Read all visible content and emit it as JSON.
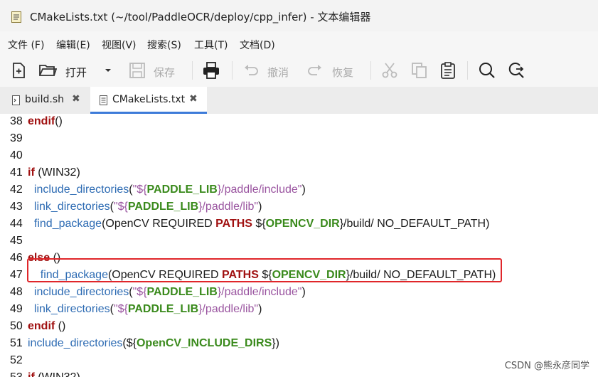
{
  "window": {
    "title": "CMakeLists.txt (~/tool/PaddleOCR/deploy/cpp_infer) - 文本编辑器"
  },
  "menu": {
    "items": [
      "文件 (F)",
      "编辑(E)",
      "视图(V)",
      "搜索(S)",
      "工具(T)",
      "文档(D)"
    ]
  },
  "toolbar": {
    "open_label": "打开",
    "save_label": "保存",
    "undo_label": "撤消",
    "redo_label": "恢复"
  },
  "tabs": [
    {
      "label": "build.sh",
      "active": false
    },
    {
      "label": "CMakeLists.txt",
      "active": true
    }
  ],
  "editor": {
    "lines": [
      {
        "n": "38",
        "tokens": [
          [
            "kw",
            "endif"
          ],
          [
            "plain",
            "()"
          ]
        ]
      },
      {
        "n": "39",
        "tokens": []
      },
      {
        "n": "40",
        "tokens": []
      },
      {
        "n": "41",
        "tokens": [
          [
            "kw",
            "if"
          ],
          [
            "plain",
            " (WIN32)"
          ]
        ]
      },
      {
        "n": "42",
        "tokens": [
          [
            "plain",
            "  "
          ],
          [
            "fn",
            "include_directories"
          ],
          [
            "plain",
            "("
          ],
          [
            "str",
            "\"${"
          ],
          [
            "var",
            "PADDLE_LIB"
          ],
          [
            "str",
            "}/paddle/include\""
          ],
          [
            "plain",
            ")"
          ]
        ]
      },
      {
        "n": "43",
        "tokens": [
          [
            "plain",
            "  "
          ],
          [
            "fn",
            "link_directories"
          ],
          [
            "plain",
            "("
          ],
          [
            "str",
            "\"${"
          ],
          [
            "var",
            "PADDLE_LIB"
          ],
          [
            "str",
            "}/paddle/lib\""
          ],
          [
            "plain",
            ")"
          ]
        ]
      },
      {
        "n": "44",
        "tokens": [
          [
            "plain",
            "  "
          ],
          [
            "fn",
            "find_package"
          ],
          [
            "plain",
            "(OpenCV REQUIRED "
          ],
          [
            "kw",
            "PATHS"
          ],
          [
            "plain",
            " ${"
          ],
          [
            "var",
            "OPENCV_DIR"
          ],
          [
            "plain",
            "}/build/ NO_DEFAULT_PATH)"
          ]
        ]
      },
      {
        "n": "45",
        "tokens": []
      },
      {
        "n": "46",
        "tokens": [
          [
            "kw",
            "else"
          ],
          [
            "plain",
            " ()"
          ]
        ]
      },
      {
        "n": "47",
        "tokens": [
          [
            "plain",
            "    "
          ],
          [
            "fn",
            "find_package"
          ],
          [
            "plain",
            "(OpenCV REQUIRED "
          ],
          [
            "kw",
            "PATHS"
          ],
          [
            "plain",
            " ${"
          ],
          [
            "var",
            "OPENCV_DIR"
          ],
          [
            "plain",
            "}/build/ NO_DEFAULT_PATH)"
          ]
        ]
      },
      {
        "n": "48",
        "tokens": [
          [
            "plain",
            "  "
          ],
          [
            "fn",
            "include_directories"
          ],
          [
            "plain",
            "("
          ],
          [
            "str",
            "\"${"
          ],
          [
            "var",
            "PADDLE_LIB"
          ],
          [
            "str",
            "}/paddle/include\""
          ],
          [
            "plain",
            ")"
          ]
        ]
      },
      {
        "n": "49",
        "tokens": [
          [
            "plain",
            "  "
          ],
          [
            "fn",
            "link_directories"
          ],
          [
            "plain",
            "("
          ],
          [
            "str",
            "\"${"
          ],
          [
            "var",
            "PADDLE_LIB"
          ],
          [
            "str",
            "}/paddle/lib\""
          ],
          [
            "plain",
            ")"
          ]
        ]
      },
      {
        "n": "50",
        "tokens": [
          [
            "kw",
            "endif"
          ],
          [
            "plain",
            " ()"
          ]
        ]
      },
      {
        "n": "51",
        "tokens": [
          [
            "fn",
            "include_directories"
          ],
          [
            "plain",
            "(${"
          ],
          [
            "var",
            "OpenCV_INCLUDE_DIRS"
          ],
          [
            "plain",
            "})"
          ]
        ]
      },
      {
        "n": "52",
        "tokens": []
      },
      {
        "n": "53",
        "tokens": [
          [
            "kw",
            "if"
          ],
          [
            "plain",
            " (WIN32)"
          ]
        ]
      }
    ]
  },
  "watermark": "CSDN @熊永彦同学",
  "colors": {
    "keyword": "#a01010",
    "function": "#2d6bb3",
    "string": "#9a55a0",
    "variable": "#3a8a1c",
    "highlight_border": "#e0262a",
    "tab_accent": "#3d7bd9"
  }
}
